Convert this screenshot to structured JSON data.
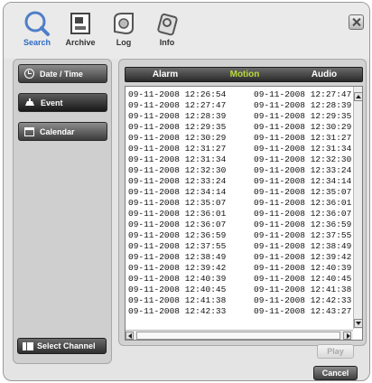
{
  "toolbar": {
    "items": [
      {
        "label": "Search",
        "icon": "search-icon",
        "active": true
      },
      {
        "label": "Archive",
        "icon": "archive-icon",
        "active": false
      },
      {
        "label": "Log",
        "icon": "log-icon",
        "active": false
      },
      {
        "label": "Info",
        "icon": "info-icon",
        "active": false
      }
    ],
    "close_icon": "close-icon"
  },
  "sidebar": {
    "items": [
      {
        "label": "Date / Time",
        "icon": "clock-icon",
        "active": false
      },
      {
        "label": "Event",
        "icon": "event-icon",
        "active": true
      },
      {
        "label": "Calendar",
        "icon": "calendar-icon",
        "active": false
      }
    ],
    "select_channel": "Select Channel"
  },
  "tabs": [
    {
      "label": "Alarm",
      "active": false
    },
    {
      "label": "Motion",
      "active": true
    },
    {
      "label": "Audio",
      "active": false
    }
  ],
  "events": [
    [
      "09-11-2008 12:26:54",
      "09-11-2008 12:27:47"
    ],
    [
      "09-11-2008 12:27:47",
      "09-11-2008 12:28:39"
    ],
    [
      "09-11-2008 12:28:39",
      "09-11-2008 12:29:35"
    ],
    [
      "09-11-2008 12:29:35",
      "09-11-2008 12:30:29"
    ],
    [
      "09-11-2008 12:30:29",
      "09-11-2008 12:31:27"
    ],
    [
      "09-11-2008 12:31:27",
      "09-11-2008 12:31:34"
    ],
    [
      "09-11-2008 12:31:34",
      "09-11-2008 12:32:30"
    ],
    [
      "09-11-2008 12:32:30",
      "09-11-2008 12:33:24"
    ],
    [
      "09-11-2008 12:33:24",
      "09-11-2008 12:34:14"
    ],
    [
      "09-11-2008 12:34:14",
      "09-11-2008 12:35:07"
    ],
    [
      "09-11-2008 12:35:07",
      "09-11-2008 12:36:01"
    ],
    [
      "09-11-2008 12:36:01",
      "09-11-2008 12:36:07"
    ],
    [
      "09-11-2008 12:36:07",
      "09-11-2008 12:36:59"
    ],
    [
      "09-11-2008 12:36:59",
      "09-11-2008 12:37:55"
    ],
    [
      "09-11-2008 12:37:55",
      "09-11-2008 12:38:49"
    ],
    [
      "09-11-2008 12:38:49",
      "09-11-2008 12:39:42"
    ],
    [
      "09-11-2008 12:39:42",
      "09-11-2008 12:40:39"
    ],
    [
      "09-11-2008 12:40:39",
      "09-11-2008 12:40:45"
    ],
    [
      "09-11-2008 12:40:45",
      "09-11-2008 12:41:38"
    ],
    [
      "09-11-2008 12:41:38",
      "09-11-2008 12:42:33"
    ],
    [
      "09-11-2008 12:42:33",
      "09-11-2008 12:43:27"
    ]
  ],
  "buttons": {
    "play": "Play",
    "cancel": "Cancel"
  },
  "colors": {
    "active_tab": "#b9d83c",
    "active_toolbar_label": "#2c6bc4"
  }
}
